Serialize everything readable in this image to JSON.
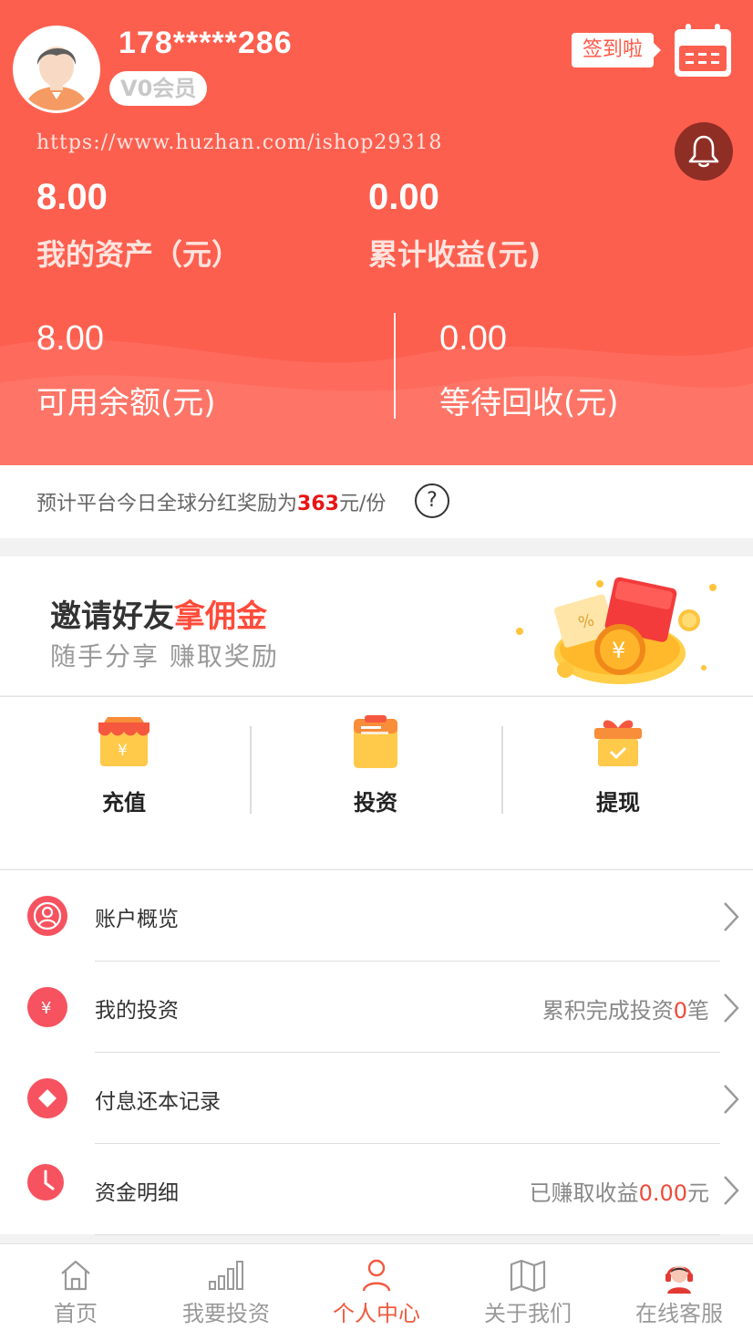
{
  "header": {
    "phone": "178*****286",
    "vip_badge": "V0会员",
    "signin_label": "签到啦",
    "url": "https://www.huzhan.com/ishop29318",
    "total_assets_value": "8.00",
    "total_assets_label": "我的资产（元）",
    "total_income_value": "0.00",
    "total_income_label": "累计收益(元)",
    "available_value": "8.00",
    "available_label": "可用余额(元)",
    "pending_value": "0.00",
    "pending_label": "等待回收(元)"
  },
  "notice": {
    "prefix": "预计平台今日全球分红奖励为",
    "amount": "363",
    "suffix": "元/份",
    "help": "?"
  },
  "invite": {
    "title_part1": "邀请好友",
    "title_part2": "拿佣金",
    "subtitle": "随手分享 赚取奖励"
  },
  "actions": [
    {
      "label": "充值",
      "icon": "recharge-shop-icon"
    },
    {
      "label": "投资",
      "icon": "clipboard-icon"
    },
    {
      "label": "提现",
      "icon": "gift-box-icon"
    }
  ],
  "menu": [
    {
      "label": "账户概览",
      "icon": "user-icon",
      "info_pre": "",
      "info_red": "",
      "info_post": ""
    },
    {
      "label": "我的投资",
      "icon": "yen-icon",
      "info_pre": "累积完成投资",
      "info_red": "0",
      "info_post": "笔"
    },
    {
      "label": "付息还本记录",
      "icon": "diamond-icon",
      "info_pre": "",
      "info_red": "",
      "info_post": ""
    },
    {
      "label": "资金明细",
      "icon": "clock-icon",
      "info_pre": "已赚取收益",
      "info_red": "0.00",
      "info_post": "元"
    }
  ],
  "tabs": [
    {
      "label": "首页",
      "icon": "home-icon"
    },
    {
      "label": "我要投资",
      "icon": "bar-chart-icon"
    },
    {
      "label": "个人中心",
      "icon": "person-icon",
      "active": true
    },
    {
      "label": "关于我们",
      "icon": "map-icon"
    },
    {
      "label": "在线客服",
      "icon": "customer-service-icon"
    }
  ],
  "colors": {
    "header_bg": "#fd5f4f",
    "accent_red": "#f04a3a",
    "menu_icon_bg": "#f6525f",
    "tab_active": "#f05a3e"
  }
}
